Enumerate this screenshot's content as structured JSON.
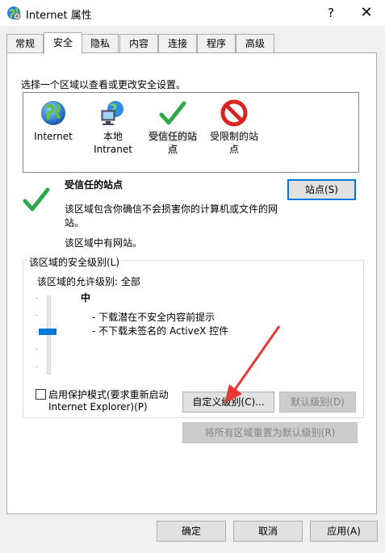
{
  "window": {
    "title": "Internet 属性",
    "help_glyph": "?",
    "close_glyph": "✕"
  },
  "tabs": [
    "常规",
    "安全",
    "隐私",
    "内容",
    "连接",
    "程序",
    "高级"
  ],
  "security": {
    "intro": "选择一个区域以查看或更改安全设置。",
    "zones": [
      {
        "line1": "Internet",
        "line2": "",
        "icon": "globe-icon"
      },
      {
        "line1": "本地",
        "line2": "Intranet",
        "icon": "intranet-icon"
      },
      {
        "line1": "受信任的站",
        "line2": "点",
        "icon": "check-icon"
      },
      {
        "line1": "受限制的站",
        "line2": "点",
        "icon": "restricted-icon"
      }
    ],
    "selected_zone_title": "受信任的站点",
    "selected_zone_desc_1": "该区域包含你确信不会损害你的计算机或文件的网",
    "selected_zone_desc_2": "站。",
    "selected_zone_note": "该区域中有网站。",
    "sites_button": "站点(S)",
    "group_title": "该区域的安全级别(L)",
    "allowed_levels": "该区域的允许级别: 全部",
    "level_name": "中",
    "level_bullet_1": "- 下载潜在不安全内容前提示",
    "level_bullet_2": "- 不下载未签名的 ActiveX 控件",
    "slider_level": "中",
    "protected_mode_1": "启用保护模式(要求重新启动",
    "protected_mode_2": "Internet Explorer)(P)",
    "protected_mode_checked": false,
    "custom_level_button": "自定义级别(C)...",
    "default_level_button": "默认级别(D)",
    "reset_all_button": "将所有区域重置为默认级别(R)"
  },
  "footer": {
    "ok": "确定",
    "cancel": "取消",
    "apply": "应用(A)"
  },
  "colors": {
    "accent": "#0078d7",
    "annotation_arrow": "#e53935"
  }
}
